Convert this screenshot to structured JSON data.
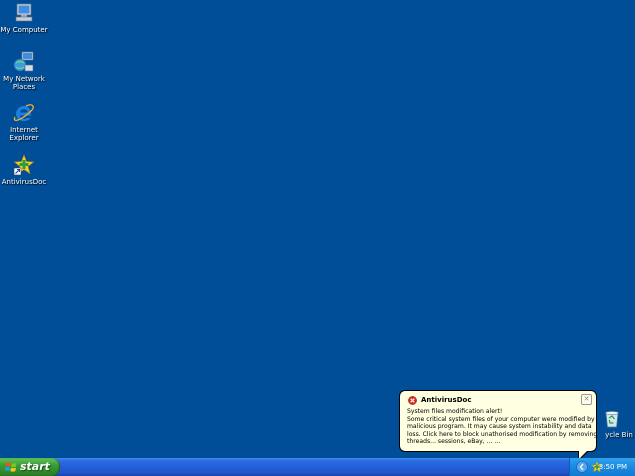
{
  "desktop": {
    "icons": [
      {
        "label": "My Computer",
        "icon": "my-computer-icon"
      },
      {
        "label": "My Network\nPlaces",
        "icon": "network-places-icon"
      },
      {
        "label": "Internet\nExplorer",
        "icon": "internet-explorer-icon"
      },
      {
        "label": "AntivirusDoc",
        "icon": "antivirus-doc-icon"
      },
      {
        "label": "ycle Bin",
        "icon": "recycle-bin-icon"
      }
    ]
  },
  "taskbar": {
    "start_label": "start",
    "clock": "3:50 PM"
  },
  "balloon": {
    "title": "AntivirusDoc",
    "close_glyph": "✕",
    "lines": [
      "System files modification alert!",
      "Some critical system files of your computer were modified by",
      "malicious program. It may cause system instability and data",
      "loss. Click here to block unathorised modification by removing",
      "threads... sessions, eBay, ... ..."
    ]
  },
  "colors": {
    "desktop_bg": "#004e98",
    "taskbar_blue": "#245edb",
    "start_green": "#3a9e35",
    "balloon_bg": "#ffffe1",
    "error_red": "#d62a1e"
  }
}
